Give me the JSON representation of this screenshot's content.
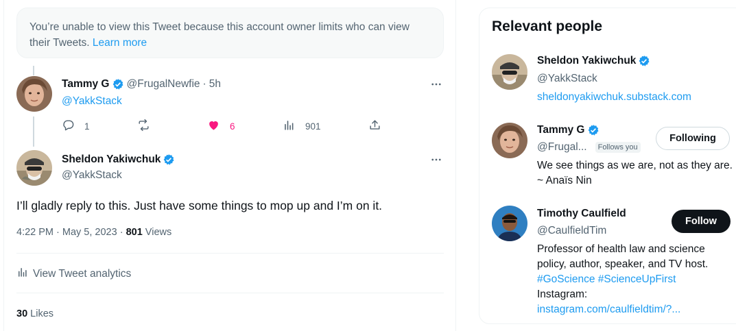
{
  "notice": {
    "text": "You’re unable to view this Tweet because this account owner limits who can view their Tweets.",
    "link": "Learn more"
  },
  "reply_tweet": {
    "display_name": "Tammy G",
    "handle": "@FrugalNewfie",
    "separator": "·",
    "time": "5h",
    "mention": "@YakkStack",
    "actions": {
      "replies": "1",
      "retweets": "",
      "likes": "6",
      "views": "901"
    }
  },
  "main_tweet": {
    "display_name": "Sheldon Yakiwchuk",
    "handle": "@YakkStack",
    "text": "I’ll gladly reply to this. Just have some things to mop up and I’m on it.",
    "timestamp": "4:22 PM · May 5, 2023 · ",
    "views_count": "801",
    "views_label": " Views",
    "analytics_label": "View Tweet analytics",
    "likes_count": "30",
    "likes_label": " Likes"
  },
  "relevant_people": {
    "title": "Relevant people",
    "people": [
      {
        "name": "Sheldon Yakiwchuk",
        "handle": "@YakkStack",
        "link": "sheldonyakiwchuk.substack.com"
      },
      {
        "name": "Tammy G",
        "handle": "@Frugal...",
        "follows_you": "Follows you",
        "button": "Following",
        "bio": "We see things as we are, not as they are. ~ Anaïs Nin"
      },
      {
        "name": "Timothy Caulfield",
        "handle": "@CaulfieldTim",
        "button": "Follow",
        "bio_text": "Professor of health law and science policy, author, speaker, and TV host.",
        "bio_tags": "#GoScience #ScienceUpFirst",
        "bio_instagram": "Instagram:",
        "bio_link": "instagram.com/caulfieldtim/?..."
      }
    ]
  },
  "colors": {
    "accent": "#1d9bf0",
    "like": "#f91880",
    "muted": "#536471",
    "text": "#0f1419"
  },
  "icons": [
    "reply-icon",
    "retweet-icon",
    "heart-icon",
    "views-icon",
    "share-icon",
    "verified-icon",
    "more-icon",
    "analytics-icon"
  ]
}
